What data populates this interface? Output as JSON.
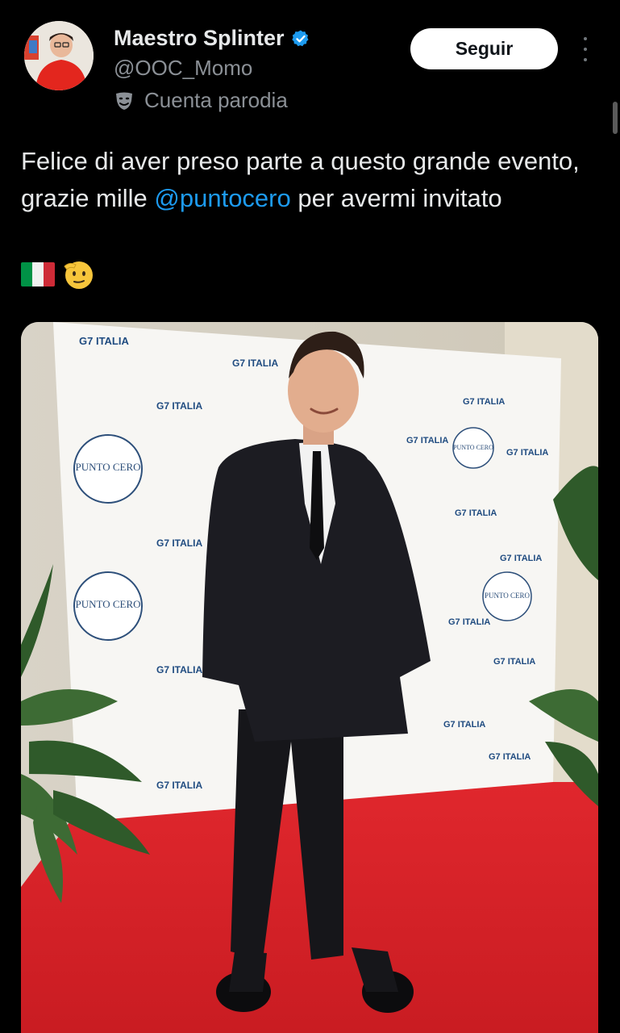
{
  "tweet": {
    "author": {
      "display_name": "Maestro Splinter",
      "handle": "@OOC_Momo",
      "label": "Cuenta parodia",
      "verified": true
    },
    "follow_label": "Seguir",
    "text_part1": "Felice di aver preso parte a questo grande evento, grazie mille ",
    "mention": "@puntocero",
    "text_part2": " per avermi invitato",
    "emojis": [
      "flag-italy",
      "saluting-face"
    ],
    "media": {
      "backdrop_logos": [
        "G7 ITALIA",
        "PUNTO CERO"
      ]
    }
  },
  "colors": {
    "background": "#000000",
    "text_primary": "#e7e9ea",
    "text_secondary": "#8b9096",
    "link": "#1d9bf0",
    "verified": "#1d9bf0"
  }
}
